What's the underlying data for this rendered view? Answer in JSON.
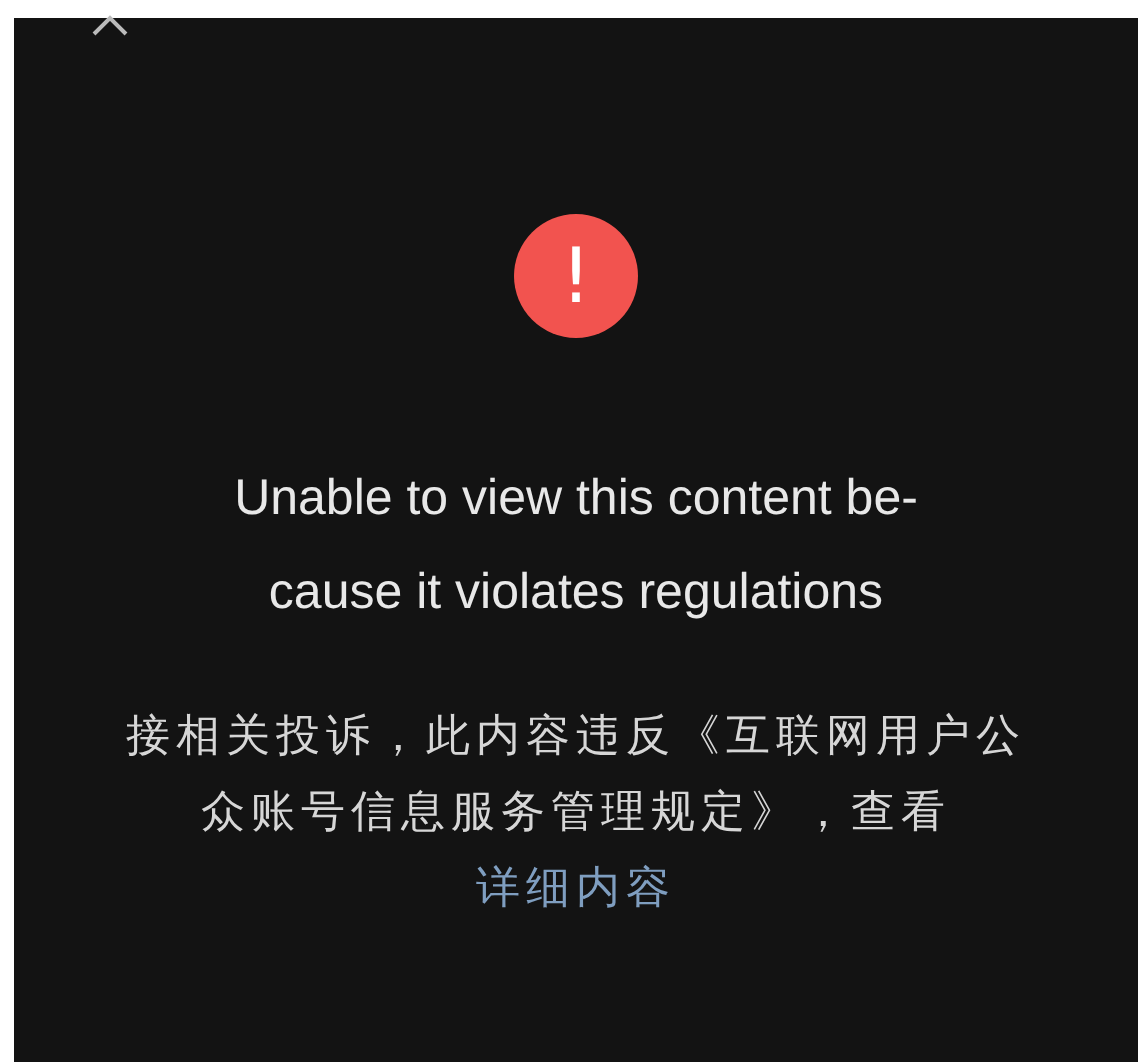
{
  "alert": {
    "icon": "!",
    "title": "Unable to view this content be-\ncause it violates regulations",
    "message": "接相关投诉，此内容违反《互联网用户公众账号信息服务管理规定》，查看",
    "link": "详细内容"
  }
}
